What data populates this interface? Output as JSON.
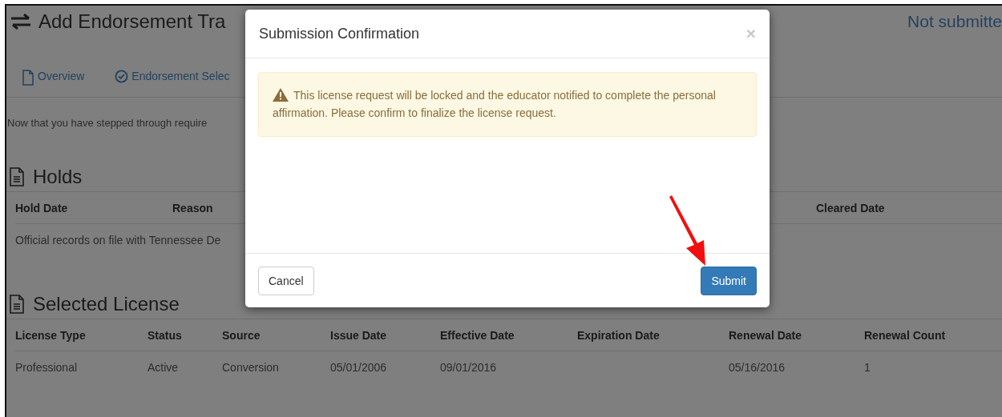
{
  "page": {
    "title": "Add Endorsement Tra",
    "status": "Not submitte",
    "nav": [
      {
        "label": "Overview",
        "kind": "document"
      },
      {
        "label": "Endorsement Selec",
        "kind": "check"
      }
    ],
    "intro": "Now that you have stepped through require",
    "holds": {
      "heading": "Holds",
      "columns": [
        "Hold Date",
        "Reason",
        "Cleared Date"
      ],
      "note": "Official records on file with Tennessee De"
    },
    "license": {
      "heading": "Selected License",
      "columns": [
        "License Type",
        "Status",
        "Source",
        "Issue Date",
        "Effective Date",
        "Expiration Date",
        "Renewal Date",
        "Renewal Count"
      ],
      "rows": [
        [
          "Professional",
          "Active",
          "Conversion",
          "05/01/2006",
          "09/01/2016",
          "",
          "05/16/2016",
          "1"
        ]
      ]
    }
  },
  "dialog": {
    "title": "Submission Confirmation",
    "close": "×",
    "message": "This license request will be locked and the educator notified to complete the personal affirmation. Please confirm to finalize the license request.",
    "buttons": [
      {
        "label": "Cancel",
        "kind": "default"
      },
      {
        "label": "Submit",
        "kind": "primary"
      }
    ]
  }
}
